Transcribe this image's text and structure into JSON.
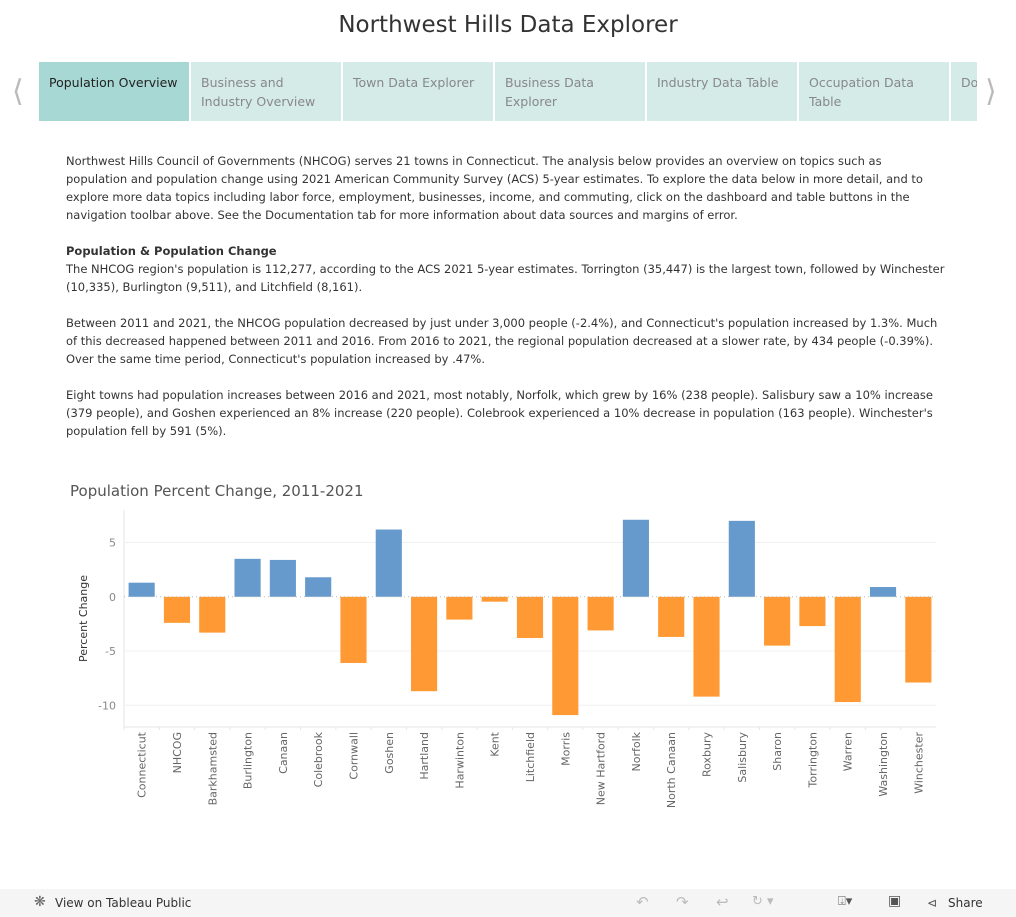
{
  "header": {
    "title": "Northwest Hills Data Explorer"
  },
  "nav": {
    "prev_icon": "chevron-left-icon",
    "next_icon": "chevron-right-icon",
    "tabs": [
      {
        "label": "Population Overview",
        "active": true
      },
      {
        "label": "Business and Industry Overview"
      },
      {
        "label": "Town Data Explorer"
      },
      {
        "label": "Business Data Explorer"
      },
      {
        "label": "Industry Data Table"
      },
      {
        "label": "Occupation Data Table"
      },
      {
        "label": "Do"
      }
    ]
  },
  "content": {
    "intro": "Northwest Hills Council of Governments (NHCOG) serves 21 towns in Connecticut. The analysis below provides an overview on topics such as population and population change using 2021 American Community Survey (ACS) 5-year estimates. To explore the data below in more detail, and to explore more data topics including labor force, employment, businesses, income, and commuting, click on the dashboard and table buttons in the navigation toolbar above. See the Documentation tab for more information about data sources and margins of error.",
    "section_heading": "Population & Population Change",
    "para1": "The NHCOG region's population is 112,277, according to the ACS 2021 5-year estimates. Torrington (35,447) is the largest town, followed by Winchester (10,335), Burlington (9,511), and Litchfield (8,161).",
    "para2": "Between 2011 and 2021, the NHCOG population decreased by just under 3,000 people (-2.4%), and Connecticut's population increased by 1.3%. Much of this decreased happened between 2011 and 2016. From 2016 to 2021, the regional population decreased at a slower rate, by 434 people (-0.39%). Over the same time period, Connecticut's population increased by .47%.",
    "para3": "Eight towns had population increases between 2016 and 2021, most notably, Norfolk, which grew by 16% (238 people). Salisbury saw a 10% increase (379 people), and Goshen experienced an 8% increase (220 people). Colebrook experienced a 10% decrease in population (163 people). Winchester's population fell by 591 (5%)."
  },
  "chart_data": {
    "type": "bar",
    "title": "Population Percent Change, 2011-2021",
    "xlabel": "",
    "ylabel": "Percent Change",
    "ylim": [
      -12,
      8
    ],
    "yticks": [
      5,
      0,
      -5,
      -10
    ],
    "grid": true,
    "colors": {
      "positive": "#6699cc",
      "negative": "#ff9933"
    },
    "categories": [
      "Connecticut",
      "NHCOG",
      "Barkhamsted",
      "Burlington",
      "Canaan",
      "Colebrook",
      "Cornwall",
      "Goshen",
      "Hartland",
      "Harwinton",
      "Kent",
      "Litchfield",
      "Morris",
      "New Hartford",
      "Norfolk",
      "North Canaan",
      "Roxbury",
      "Salisbury",
      "Sharon",
      "Torrington",
      "Warren",
      "Washington",
      "Winchester"
    ],
    "values": [
      1.3,
      -2.4,
      -3.3,
      3.5,
      3.4,
      1.8,
      -6.1,
      6.2,
      -8.7,
      -2.1,
      -0.45,
      -3.8,
      -10.9,
      -3.1,
      7.1,
      -3.7,
      -9.2,
      7.0,
      -4.5,
      -2.7,
      -9.7,
      0.9,
      -7.9
    ]
  },
  "footer": {
    "view_label": "View on Tableau Public",
    "view_icon": "tableau-logo-icon",
    "share_label": "Share",
    "icons": [
      "undo-icon",
      "redo-icon",
      "revert-icon",
      "refresh-icon",
      "download-icon",
      "fullscreen-icon",
      "share-icon"
    ]
  }
}
